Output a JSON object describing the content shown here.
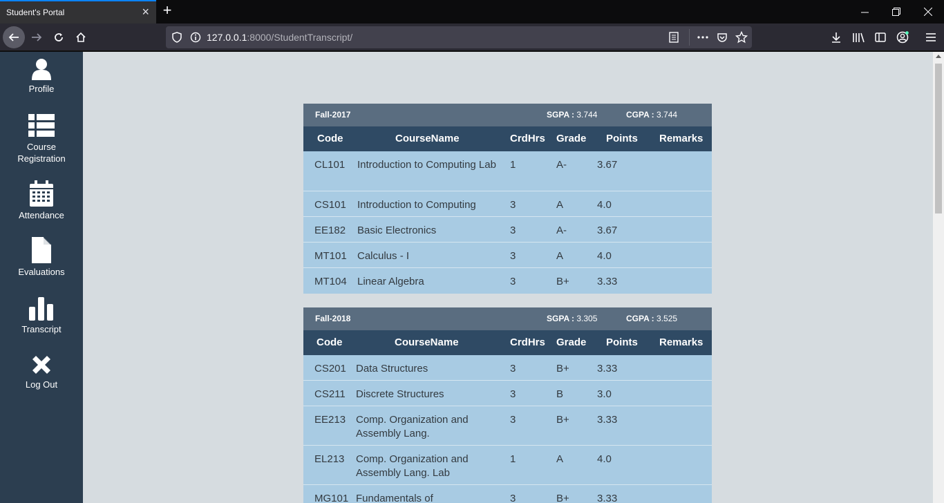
{
  "browser": {
    "tab_title": "Student's Portal",
    "url_host": "127.0.0.1",
    "url_rest": ":8000/StudentTranscript/"
  },
  "sidebar": {
    "items": [
      {
        "label": "Profile",
        "icon": "user-icon"
      },
      {
        "label": "Course Registration",
        "icon": "list-icon"
      },
      {
        "label": "Attendance",
        "icon": "calendar-icon"
      },
      {
        "label": "Evaluations",
        "icon": "file-icon"
      },
      {
        "label": "Transcript",
        "icon": "bar-chart-icon"
      },
      {
        "label": "Log Out",
        "icon": "close-icon"
      }
    ]
  },
  "columns": [
    "Code",
    "CourseName",
    "CrdHrs",
    "Grade",
    "Points",
    "Remarks"
  ],
  "semesters": [
    {
      "term": "Fall-2017",
      "sgpa_label": "SGPA :",
      "sgpa": "3.744",
      "cgpa_label": "CGPA :",
      "cgpa": "3.744",
      "courses": [
        {
          "code": "CL101",
          "name": "Introduction to Computing Lab",
          "hrs": "1",
          "grade": "A-",
          "points": "3.67",
          "remarks": ""
        },
        {
          "code": "CS101",
          "name": "Introduction to Computing",
          "hrs": "3",
          "grade": "A",
          "points": "4.0",
          "remarks": ""
        },
        {
          "code": "EE182",
          "name": "Basic Electronics",
          "hrs": "3",
          "grade": "A-",
          "points": "3.67",
          "remarks": ""
        },
        {
          "code": "MT101",
          "name": "Calculus - I",
          "hrs": "3",
          "grade": "A",
          "points": "4.0",
          "remarks": ""
        },
        {
          "code": "MT104",
          "name": "Linear Algebra",
          "hrs": "3",
          "grade": "B+",
          "points": "3.33",
          "remarks": ""
        }
      ]
    },
    {
      "term": "Fall-2018",
      "sgpa_label": "SGPA :",
      "sgpa": "3.305",
      "cgpa_label": "CGPA :",
      "cgpa": "3.525",
      "courses": [
        {
          "code": "CS201",
          "name": "Data Structures",
          "hrs": "3",
          "grade": "B+",
          "points": "3.33",
          "remarks": ""
        },
        {
          "code": "CS211",
          "name": "Discrete Structures",
          "hrs": "3",
          "grade": "B",
          "points": "3.0",
          "remarks": ""
        },
        {
          "code": "EE213",
          "name": "Comp. Organization and Assembly Lang.",
          "hrs": "3",
          "grade": "B+",
          "points": "3.33",
          "remarks": ""
        },
        {
          "code": "EL213",
          "name": "Comp. Organization and Assembly Lang. Lab",
          "hrs": "1",
          "grade": "A",
          "points": "4.0",
          "remarks": ""
        },
        {
          "code": "MG101",
          "name": "Fundamentals of",
          "hrs": "3",
          "grade": "B+",
          "points": "3.33",
          "remarks": ""
        }
      ]
    }
  ]
}
